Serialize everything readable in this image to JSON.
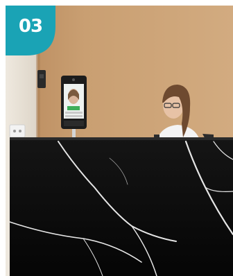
{
  "badge": {
    "label": "03",
    "color": "#1aa3b5"
  },
  "colors": {
    "wall": "#c79b6e",
    "left_wall": "#e8e2d8",
    "counter": "#0b0b0b",
    "marble_vein": "#e6e6e6",
    "kiosk_frame": "#1c1c1c",
    "kiosk_screen": "#eef2f0",
    "kiosk_stand": "#cfcfcf"
  },
  "icons": [
    "wall-sensor-icon",
    "face-recognition-kiosk",
    "receptionist-person",
    "wall-outlet-icon"
  ]
}
